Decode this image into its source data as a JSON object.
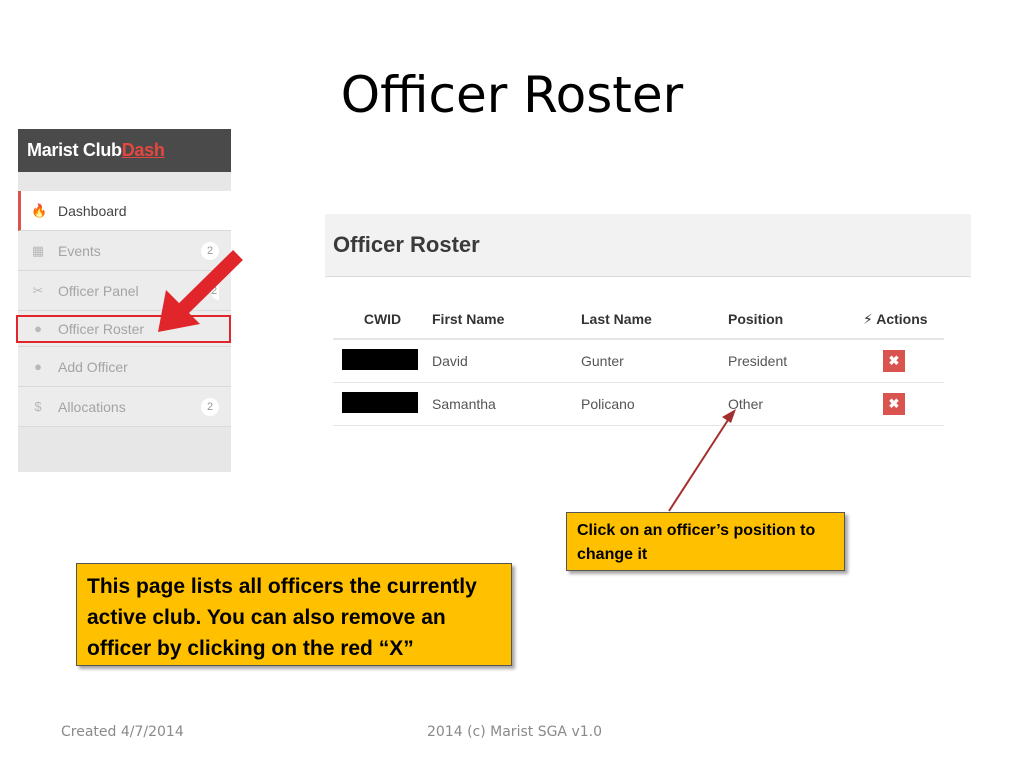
{
  "slide": {
    "title": "Officer Roster",
    "footer_left": "Created 4/7/2014",
    "footer_center": "2014 (c) Marist SGA v1.0"
  },
  "sidebar": {
    "brand_main": "Marist Club",
    "brand_accent": "Dash",
    "items": [
      {
        "label": "Dashboard",
        "icon": "fire-icon",
        "glyph": "🔥",
        "badge": ""
      },
      {
        "label": "Events",
        "icon": "calendar-icon",
        "glyph": "▦",
        "badge": "2"
      },
      {
        "label": "Officer Panel",
        "icon": "wrench-icon",
        "glyph": "✂",
        "badge": "2"
      },
      {
        "label": "Officer Roster",
        "icon": "user-icon",
        "glyph": "●",
        "badge": ""
      },
      {
        "label": "Add Officer",
        "icon": "add-user-icon",
        "glyph": "●",
        "badge": ""
      },
      {
        "label": "Allocations",
        "icon": "dollar-icon",
        "glyph": "$",
        "badge": "2"
      }
    ]
  },
  "panel": {
    "title": "Officer Roster"
  },
  "table": {
    "headers": {
      "cwid": "CWID",
      "first": "First Name",
      "last": "Last Name",
      "position": "Position",
      "actions": "Actions",
      "actions_icon": "⚡"
    },
    "rows": [
      {
        "first": "David",
        "last": "Gunter",
        "position": "President",
        "delete": "✖"
      },
      {
        "first": "Samantha",
        "last": "Policano",
        "position": "Other",
        "delete": "✖"
      }
    ]
  },
  "callouts": {
    "position": "Click on an officer’s position to change it",
    "info": "This page lists all officers the currently active club. You can also remove an officer by clicking on the red “X”"
  },
  "colors": {
    "accent_red": "#d9534f",
    "callout_yellow": "#ffc000",
    "arrow_red": "#e0262b",
    "pointer_arrow": "#a3302f"
  }
}
